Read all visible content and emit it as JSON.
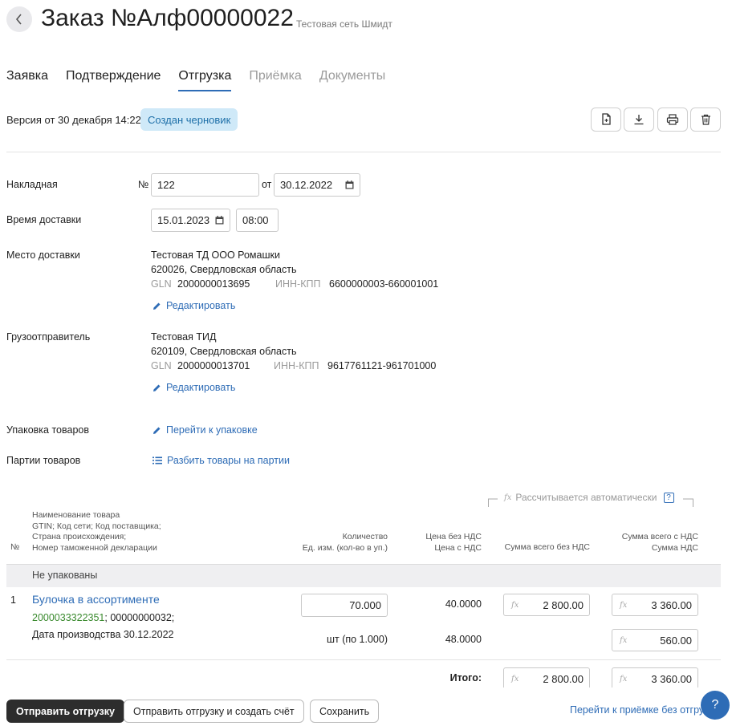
{
  "header": {
    "title": "Заказ №Алф00000022",
    "subtitle": "Тестовая сеть Шмидт"
  },
  "tabs": [
    {
      "label": "Заявка",
      "state": "normal"
    },
    {
      "label": "Подтверждение",
      "state": "normal"
    },
    {
      "label": "Отгрузка",
      "state": "active"
    },
    {
      "label": "Приёмка",
      "state": "disabled"
    },
    {
      "label": "Документы",
      "state": "disabled"
    }
  ],
  "version": {
    "text": "Версия от 30 декабря 14:22",
    "badge": "Создан черновик"
  },
  "form": {
    "invoice": {
      "label": "Накладная",
      "num_prefix": "№",
      "number": "122",
      "date_prefix": "от",
      "date": "30.12.2022"
    },
    "delivery_time": {
      "label": "Время доставки",
      "date": "15.01.2023",
      "time": "08:00"
    },
    "delivery_place": {
      "label": "Место доставки",
      "name": "Тестовая ТД ООО Ромашки",
      "address": "620026, Свердловская область",
      "gln_label": "GLN",
      "gln": "2000000013695",
      "inn_label": "ИНН-КПП",
      "inn": "6600000003-660001001",
      "edit_link": "Редактировать"
    },
    "shipper": {
      "label": "Грузоотправитель",
      "name": "Тестовая ТИД",
      "address": "620109, Свердловская область",
      "gln_label": "GLN",
      "gln": "2000000013701",
      "inn_label": "ИНН-КПП",
      "inn": "9617761121-961701000",
      "edit_link": "Редактировать"
    },
    "packaging": {
      "label": "Упаковка товаров",
      "link": "Перейти к упаковке"
    },
    "batches": {
      "label": "Партии товаров",
      "link": "Разбить товары на партии"
    }
  },
  "table": {
    "auto_calc": "Рассчитывается автоматически",
    "auto_help": "?",
    "headers": {
      "num": "№",
      "name_lines": [
        "Наименование товара",
        "GTIN; Код сети; Код поставщика;",
        "Страна происхождения;",
        "Номер таможенной декларации"
      ],
      "qty_lines": [
        "Количество",
        "Ед. изм. (кол-во в уп.)"
      ],
      "price_lines": [
        "Цена без НДС",
        "Цена с НДС"
      ],
      "sum_no_vat": "Сумма всего без НДС",
      "sum_vat_lines": [
        "Сумма всего с НДС",
        "Сумма НДС"
      ]
    },
    "group": "Не упакованы",
    "rows": [
      {
        "num": "1",
        "name": "Булочка в ассортименте",
        "gtin": "2000033322351",
        "codes": "; 00000000032;",
        "production": "Дата производства 30.12.2022",
        "qty": "70.000",
        "unit": "шт (по 1.000)",
        "price_no_vat": "40.0000",
        "price_vat": "48.0000",
        "sum_no_vat": "2 800.00",
        "sum_vat": "3 360.00",
        "vat": "560.00"
      }
    ],
    "total": {
      "label": "Итого:",
      "sum_no_vat": "2 800.00",
      "sum_vat": "3 360.00"
    },
    "fx_label": "fx"
  },
  "actions": {
    "send": "Отправить отгрузку",
    "send_invoice": "Отправить отгрузку и создать счёт",
    "save": "Сохранить",
    "go_receipt": "Перейти к приёмке без отгрузки",
    "help": "?"
  },
  "colors": {
    "accent": "#2e6cb6",
    "badge_bg": "#cfe9f8",
    "gtin_green": "#3a8a2e"
  }
}
